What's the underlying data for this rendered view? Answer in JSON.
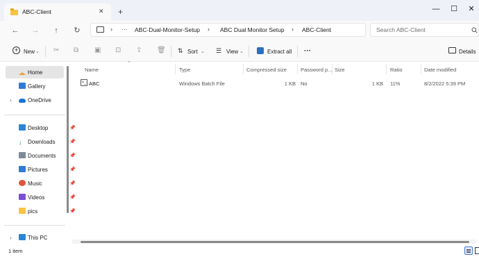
{
  "window": {
    "tab_title": "ABC-Client",
    "tab_close": "✕",
    "new_tab": "+",
    "minimize": "—",
    "maximize": "☐",
    "close": "✕"
  },
  "nav": {
    "back": "←",
    "forward": "→",
    "up": "↑",
    "refresh": "↻",
    "breadcrumbs": [
      "ABC-Dual-Monitor-Setup",
      "ABC Dual Monitor Setup",
      "ABC-Client"
    ],
    "more": "···",
    "search_placeholder": "Search ABC-Client"
  },
  "commands": {
    "new": "New",
    "sort": "Sort",
    "view": "View",
    "extract_all": "Extract all",
    "more": "···",
    "details": "Details"
  },
  "sidebar": {
    "items": [
      {
        "label": "Home",
        "icon": "home-icon",
        "pinned": false
      },
      {
        "label": "Gallery",
        "icon": "gallery-icon",
        "pinned": false
      },
      {
        "label": "OneDrive",
        "icon": "cloud-icon",
        "pinned": false
      },
      {
        "label": "Desktop",
        "icon": "desktop-icon",
        "pinned": true
      },
      {
        "label": "Downloads",
        "icon": "download-icon",
        "pinned": true
      },
      {
        "label": "Documents",
        "icon": "document-icon",
        "pinned": true
      },
      {
        "label": "Pictures",
        "icon": "pictures-icon",
        "pinned": true
      },
      {
        "label": "Music",
        "icon": "music-icon",
        "pinned": true
      },
      {
        "label": "Videos",
        "icon": "video-icon",
        "pinned": true
      },
      {
        "label": "pics",
        "icon": "folder-icon",
        "pinned": true
      },
      {
        "label": "This PC",
        "icon": "pc-icon",
        "pinned": false
      }
    ]
  },
  "table": {
    "headers": {
      "name": "Name",
      "type": "Type",
      "compressed_size": "Compressed size",
      "password": "Password p...",
      "size": "Size",
      "ratio": "Ratio",
      "date_modified": "Date modified"
    },
    "rows": [
      {
        "name": "ABC",
        "type": "Windows Batch File",
        "compressed_size": "1 KB",
        "password": "No",
        "size": "1 KB",
        "ratio": "11%",
        "date_modified": "8/2/2022 5:39 PM"
      }
    ]
  },
  "status": {
    "item_count": "1 item"
  },
  "colors": {
    "accent": "#0067c0",
    "folder": "#f6c343",
    "selected_bg": "#e5e5e5"
  }
}
